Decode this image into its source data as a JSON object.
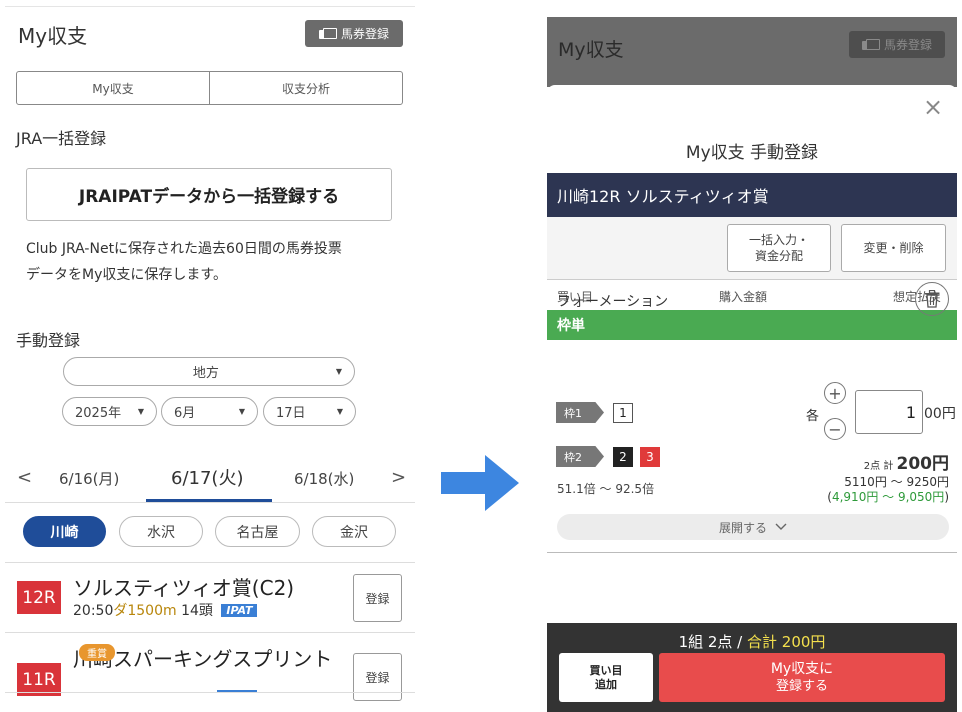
{
  "left": {
    "title": "My収支",
    "register_button": "馬券登録",
    "tabs": [
      "My収支",
      "収支分析"
    ],
    "jra_section_title": "JRA一括登録",
    "jra_button": "JRAIPATデータから一括登録する",
    "jra_desc_line1": "Club JRA-Netに保存された過去60日間の馬券投票",
    "jra_desc_line2": "データをMy収支に保存します。",
    "manual_section_title": "手動登録",
    "region_select": "地方",
    "year_select": "2025年",
    "month_select": "6月",
    "day_select": "17日",
    "date_tabs": [
      "6/16(月)",
      "6/17(火)",
      "6/18(水)"
    ],
    "prev_glyph": "<",
    "next_glyph": ">",
    "venues": [
      "川崎",
      "水沢",
      "名古屋",
      "金沢"
    ],
    "races": [
      {
        "number": "12R",
        "name": "ソルスティツィオ賞(C2)",
        "time": "20:50",
        "distance": "ダ1500m",
        "heads": "14頭",
        "ipat": "IPAT",
        "register": "登録"
      },
      {
        "number": "11R",
        "name": "川崎スパーキングスプリント",
        "grade": "重賞",
        "register": "登録"
      }
    ]
  },
  "right": {
    "dim_title": "My収支",
    "dim_register_button": "馬券登録",
    "close_glyph": "×",
    "modal_title": "My収支 手動登録",
    "race_bar": "川崎12R ソルスティツィオ賞",
    "bulk_button_line1": "一括入力・",
    "bulk_button_line2": "資金分配",
    "edit_button": "変更・削除",
    "col_headers": [
      "買い目",
      "購入金額",
      "想定払戻"
    ],
    "bet_type": "枠単",
    "formation": "フォーメーション",
    "waku1_label": "枠1",
    "waku1_numbers": [
      "1"
    ],
    "waku2_label": "枠2",
    "waku2_numbers": [
      "2",
      "3"
    ],
    "each_label": "各",
    "plus_glyph": "+",
    "minus_glyph": "−",
    "amount_value": "1",
    "amount_suffix": "00円",
    "points_label": "2点",
    "total_label": "計",
    "total_value": "200円",
    "odds_range": "51.1倍 ～ 92.5倍",
    "payout_range": "5110円 ～ 9250円",
    "payout_open": "(",
    "profit_range": "4,910円 ～ 9,050円",
    "payout_close": ")",
    "expand_label": "展開する",
    "footer_prefix": "1組 2点 /",
    "footer_total": "合計 200円",
    "add_button_line1": "買い目",
    "add_button_line2": "追加",
    "save_button_line1": "My収支に",
    "save_button_line2": "登録する"
  },
  "colors": {
    "brand_navy": "#1f4d99",
    "race_red": "#d9343a",
    "bet_green": "#4aaa52",
    "save_red": "#e84c4c",
    "arrow_blue": "#3d86e0",
    "footer_yellow": "#f4e04d"
  }
}
